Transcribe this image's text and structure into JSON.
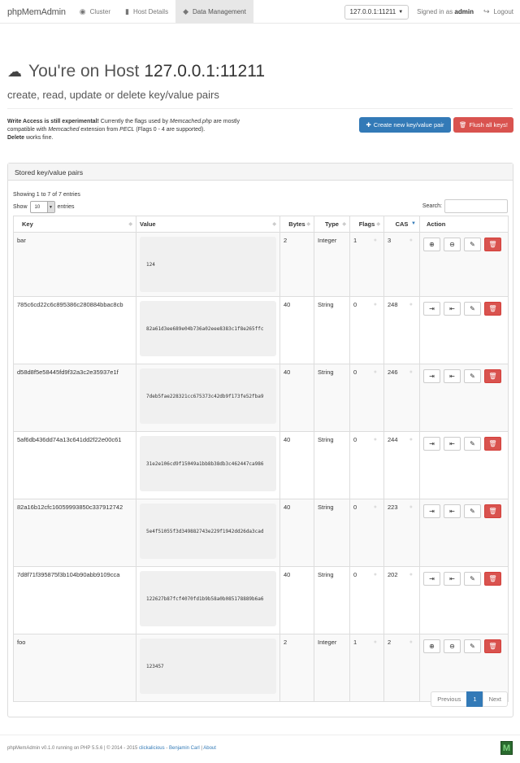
{
  "navbar": {
    "brand": "phpMemAdmin",
    "items": [
      {
        "label": "Cluster",
        "icon": "globe-icon"
      },
      {
        "label": "Host Details",
        "icon": "bar-chart-icon"
      },
      {
        "label": "Data Management",
        "icon": "tags-icon",
        "active": true
      }
    ],
    "host_selector": "127.0.0.1:11211",
    "signed_in_prefix": "Signed in as",
    "signed_in_user": "admin",
    "logout": "Logout"
  },
  "header": {
    "title_prefix": "You're on Host",
    "title_host": "127.0.0.1:11211",
    "subtitle": "create, read, update or delete key/value pairs"
  },
  "notice": {
    "bold_lead": "Write Access is still experimental!",
    "text1": " Currently the flags used by ",
    "em1": "Memcached.php",
    "text2": " are mostly compatible with ",
    "em2": "Memcached",
    "text3": " extension from ",
    "em3": "PECL",
    "text4": " (Flags 0 - 4 are supported).",
    "bold_delete": "Delete",
    "text5": " works fine."
  },
  "buttons": {
    "create": "Create new key/value pair",
    "flush": "Flush all keys!"
  },
  "panel": {
    "title": "Stored key/value pairs",
    "info": "Showing 1 to 7 of 7 entries",
    "show_label": "Show",
    "show_value": "10",
    "entries_label": "entries",
    "search_label": "Search:"
  },
  "table": {
    "headers": {
      "key": "Key",
      "value": "Value",
      "bytes": "Bytes",
      "type": "Type",
      "flags": "Flags",
      "cas": "CAS",
      "action": "Action"
    },
    "rows": [
      {
        "key": "bar",
        "value": "124",
        "bytes": "2",
        "type": "Integer",
        "flags": "1",
        "cas": "3",
        "kind": "numeric"
      },
      {
        "key": "785c6cd22c6c895386c280884bbac8cb",
        "value": "82a61d3ee689e04b736a02eee8383c1f8e265ffc",
        "bytes": "40",
        "type": "String",
        "flags": "0",
        "cas": "248",
        "kind": "string"
      },
      {
        "key": "d58d8f5e58445fd9f32a3c2e35937e1f",
        "value": "7deb5fae228321cc675373c42db9f173fe52fba9",
        "bytes": "40",
        "type": "String",
        "flags": "0",
        "cas": "246",
        "kind": "string"
      },
      {
        "key": "5af6db436dd74a13c641dd2f22e00c61",
        "value": "31e2e106cd9f15049a1bb8b38db3c462447ca986",
        "bytes": "40",
        "type": "String",
        "flags": "0",
        "cas": "244",
        "kind": "string"
      },
      {
        "key": "82a16b12cfc16059993850c337912742",
        "value": "5e4f51055f3d349882743e229f1942dd26da3cad",
        "bytes": "40",
        "type": "String",
        "flags": "0",
        "cas": "223",
        "kind": "string"
      },
      {
        "key": "7d8f71f395875f3b104b90abb9109cca",
        "value": "122627b87fcf4070fd1b9b58a0b085178889b6a6",
        "bytes": "40",
        "type": "String",
        "flags": "0",
        "cas": "202",
        "kind": "string"
      },
      {
        "key": "foo",
        "value": "123457",
        "bytes": "2",
        "type": "Integer",
        "flags": "1",
        "cas": "2",
        "kind": "numeric"
      }
    ]
  },
  "pagination": {
    "previous": "Previous",
    "current": "1",
    "next": "Next"
  },
  "footer": {
    "text": "phpMemAdmin v0.1.0 running on PHP 5.5.6 | © 2014 - 2015 ",
    "link1": "clickalicious",
    "sep": " - ",
    "link2": "Benjamin Carl",
    "sep2": " | ",
    "link3": "About",
    "logo_letter": "M"
  }
}
